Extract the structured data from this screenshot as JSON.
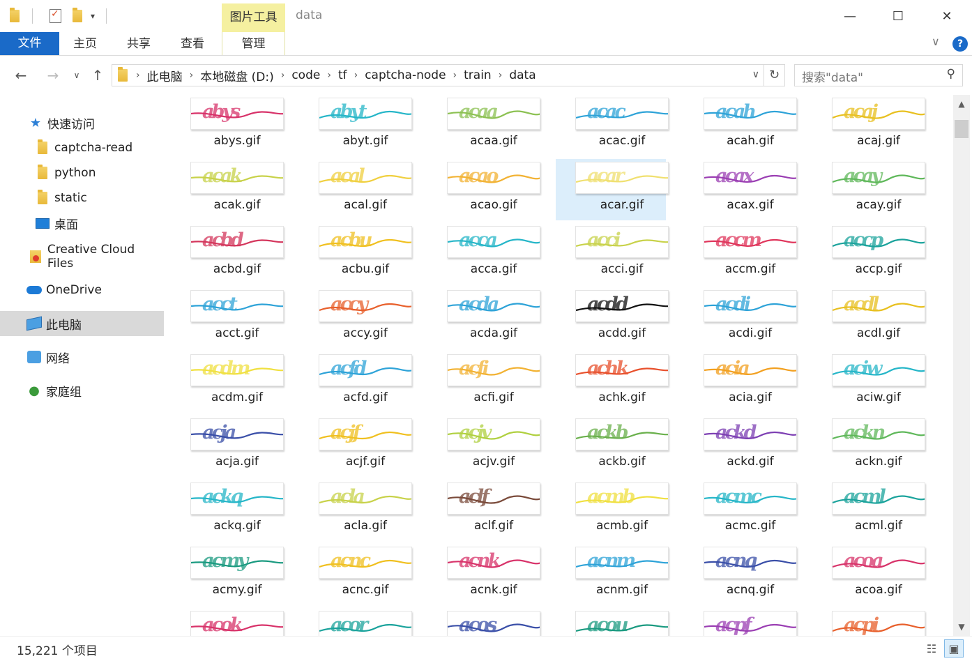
{
  "window": {
    "title": "data",
    "context_tab": "图片工具",
    "minimize": "—",
    "maximize": "☐",
    "close": "✕"
  },
  "ribbon": {
    "tabs": [
      "文件",
      "主页",
      "共享",
      "查看",
      "管理"
    ],
    "help": "?"
  },
  "address": {
    "crumbs": [
      "此电脑",
      "本地磁盘 (D:)",
      "code",
      "tf",
      "captcha-node",
      "train",
      "data"
    ],
    "search_placeholder": "搜索\"data\""
  },
  "nav": {
    "quick_access": "快速访问",
    "quick_items": [
      "captcha-read",
      "python",
      "static",
      "桌面"
    ],
    "creative_cloud": "Creative Cloud Files",
    "onedrive": "OneDrive",
    "this_pc": "此电脑",
    "network": "网络",
    "homegroup": "家庭组"
  },
  "files": [
    {
      "name": "abys.gif",
      "text": "abys",
      "color": "#d8336a"
    },
    {
      "name": "abyt.gif",
      "text": "abyt",
      "color": "#26b6c8"
    },
    {
      "name": "acaa.gif",
      "text": "acaa",
      "color": "#8cc152"
    },
    {
      "name": "acac.gif",
      "text": "acac",
      "color": "#2ea3d8"
    },
    {
      "name": "acah.gif",
      "text": "acah",
      "color": "#2ea3d8"
    },
    {
      "name": "acaj.gif",
      "text": "acaj",
      "color": "#e8c020"
    },
    {
      "name": "acak.gif",
      "text": "acak",
      "color": "#c8d24a"
    },
    {
      "name": "acal.gif",
      "text": "acal",
      "color": "#f0d040"
    },
    {
      "name": "acao.gif",
      "text": "acao",
      "color": "#f2b233"
    },
    {
      "name": "acar.gif",
      "text": "acar",
      "color": "#f0e070"
    },
    {
      "name": "acax.gif",
      "text": "acax",
      "color": "#9b3fb3"
    },
    {
      "name": "acay.gif",
      "text": "acay",
      "color": "#5fb85a"
    },
    {
      "name": "acbd.gif",
      "text": "acbd",
      "color": "#d4365c"
    },
    {
      "name": "acbu.gif",
      "text": "acbu",
      "color": "#f0c020"
    },
    {
      "name": "acca.gif",
      "text": "acca",
      "color": "#26b6c8"
    },
    {
      "name": "acci.gif",
      "text": "acci",
      "color": "#c8d24a"
    },
    {
      "name": "accm.gif",
      "text": "accm",
      "color": "#e0365c"
    },
    {
      "name": "accp.gif",
      "text": "accp",
      "color": "#1ba39c"
    },
    {
      "name": "acct.gif",
      "text": "acct",
      "color": "#2ea3d8"
    },
    {
      "name": "accy.gif",
      "text": "accy",
      "color": "#e8602c"
    },
    {
      "name": "acda.gif",
      "text": "acda",
      "color": "#2ea3d8"
    },
    {
      "name": "acdd.gif",
      "text": "acdd",
      "color": "#111111"
    },
    {
      "name": "acdi.gif",
      "text": "acdi",
      "color": "#2ea3d8"
    },
    {
      "name": "acdl.gif",
      "text": "acdl",
      "color": "#e8c020"
    },
    {
      "name": "acdm.gif",
      "text": "acdm",
      "color": "#f0e040"
    },
    {
      "name": "acfd.gif",
      "text": "acfd",
      "color": "#2ea3d8"
    },
    {
      "name": "acfi.gif",
      "text": "acfi",
      "color": "#f2b233"
    },
    {
      "name": "achk.gif",
      "text": "achk",
      "color": "#e8502c"
    },
    {
      "name": "acia.gif",
      "text": "acia",
      "color": "#f2a020"
    },
    {
      "name": "aciw.gif",
      "text": "aciw",
      "color": "#26b6c8"
    },
    {
      "name": "acja.gif",
      "text": "acja",
      "color": "#3a4fa8"
    },
    {
      "name": "acjf.gif",
      "text": "acjf",
      "color": "#f0c020"
    },
    {
      "name": "acjv.gif",
      "text": "acjv",
      "color": "#b0d040"
    },
    {
      "name": "ackb.gif",
      "text": "ackb",
      "color": "#6ab04c"
    },
    {
      "name": "ackd.gif",
      "text": "ackd",
      "color": "#7d3fb3"
    },
    {
      "name": "ackn.gif",
      "text": "ackn",
      "color": "#5fb85a"
    },
    {
      "name": "ackq.gif",
      "text": "ackq",
      "color": "#26b6c8"
    },
    {
      "name": "acla.gif",
      "text": "acla",
      "color": "#c8d24a"
    },
    {
      "name": "aclf.gif",
      "text": "aclf",
      "color": "#7a4a3a"
    },
    {
      "name": "acmb.gif",
      "text": "acmb",
      "color": "#f0e040"
    },
    {
      "name": "acmc.gif",
      "text": "acmc",
      "color": "#26b6c8"
    },
    {
      "name": "acml.gif",
      "text": "acml",
      "color": "#1ba39c"
    },
    {
      "name": "acmy.gif",
      "text": "acmy",
      "color": "#1a9a80"
    },
    {
      "name": "acnc.gif",
      "text": "acnc",
      "color": "#f0c020"
    },
    {
      "name": "acnk.gif",
      "text": "acnk",
      "color": "#d8336a"
    },
    {
      "name": "acnm.gif",
      "text": "acnm",
      "color": "#2ea3d8"
    },
    {
      "name": "acnq.gif",
      "text": "acnq",
      "color": "#3a4fa8"
    },
    {
      "name": "acoa.gif",
      "text": "acoa",
      "color": "#d8336a"
    },
    {
      "name": "",
      "text": "acok",
      "color": "#d8336a"
    },
    {
      "name": "",
      "text": "acor",
      "color": "#1ba39c"
    },
    {
      "name": "",
      "text": "acos",
      "color": "#3a4fa8"
    },
    {
      "name": "",
      "text": "acou",
      "color": "#1a9a80"
    },
    {
      "name": "",
      "text": "acpf",
      "color": "#9b3fb3"
    },
    {
      "name": "",
      "text": "acpi",
      "color": "#e8602c"
    }
  ],
  "selected_file": "acar.gif",
  "status": {
    "item_count": "15,221 个项目"
  }
}
